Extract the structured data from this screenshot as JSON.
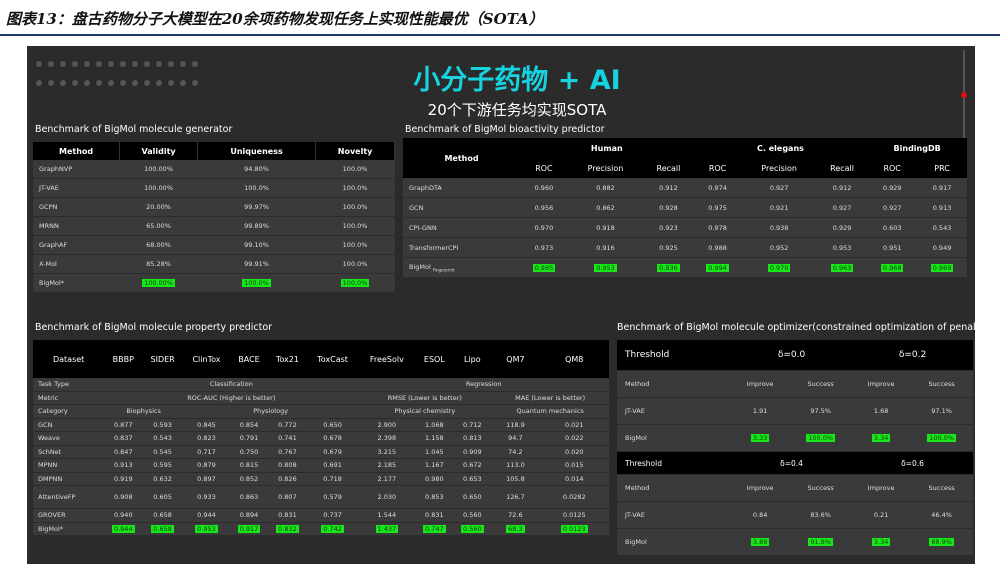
{
  "figure_title": "图表13：盘古药物分子大模型在20余项药物发现任务上实现性能最优（SOTA）",
  "hero": {
    "title": "小分子药物 + AI",
    "subtitle": "20个下游任务均实现SOTA"
  },
  "generator": {
    "heading": "Benchmark of BigMol molecule generator",
    "columns": [
      "Method",
      "Validity",
      "Uniqueness",
      "Novelty"
    ],
    "rows": [
      [
        "GraphNVP",
        "100.00%",
        "94.80%",
        "100.0%"
      ],
      [
        "JT-VAE",
        "100.00%",
        "100.0%",
        "100.0%"
      ],
      [
        "GCPN",
        "20.00%",
        "99.97%",
        "100.0%"
      ],
      [
        "MRNN",
        "65.00%",
        "99.89%",
        "100.0%"
      ],
      [
        "GraphAF",
        "68.00%",
        "99.10%",
        "100.0%"
      ],
      [
        "X-Mol",
        "85.28%",
        "99.91%",
        "100.0%"
      ]
    ],
    "best_row": [
      "BigMol*",
      "100.00%",
      "100.0%",
      "100.0%"
    ]
  },
  "bioactivity": {
    "heading": "Benchmark of BigMol bioactivity predictor",
    "method_label": "Method",
    "groups": [
      "Human",
      "C. elegans",
      "BindingDB"
    ],
    "metrics": [
      "ROC",
      "Precision",
      "Recall",
      "ROC",
      "Precision",
      "Recall",
      "ROC",
      "PRC"
    ],
    "rows": [
      [
        "GraphDTA",
        "0.960",
        "0.882",
        "0.912",
        "0.974",
        "0.927",
        "0.912",
        "0.929",
        "0.917"
      ],
      [
        "GCN",
        "0.956",
        "0.862",
        "0.928",
        "0.975",
        "0.921",
        "0.927",
        "0.927",
        "0.913"
      ],
      [
        "CPI-GNN",
        "0.970",
        "0.918",
        "0.923",
        "0.978",
        "0.938",
        "0.929",
        "0.603",
        "0.543"
      ],
      [
        "TransformerCPI",
        "0.973",
        "0.916",
        "0.925",
        "0.988",
        "0.952",
        "0.953",
        "0.951",
        "0.949"
      ]
    ],
    "best_row": [
      "BigMol",
      "0.985",
      "0.953",
      "0.936",
      "0.994",
      "0.970",
      "0.963",
      "0.968",
      "0.969"
    ],
    "best_row_suffix": "Fingerprint"
  },
  "property": {
    "heading": "Benchmark of BigMol molecule property predictor",
    "columns": [
      "Dataset",
      "BBBP",
      "SIDER",
      "ClinTox",
      "BACE",
      "Tox21",
      "ToxCast",
      "FreeSolv",
      "ESOL",
      "Lipo",
      "QM7",
      "QM8"
    ],
    "task_type": {
      "label": "Task Type",
      "classification": "Classification",
      "regression": "Regression"
    },
    "metric": {
      "label": "Metric",
      "roc": "ROC-AUC (Higher is better)",
      "rmse": "RMSE (Lower is better)",
      "mae": "MAE (Lower is better)"
    },
    "category": {
      "label": "Category",
      "biophysics": "Biophysics",
      "physiology": "Physiology",
      "physchem": "Physical chemistry",
      "quantum": "Quantum mechanics"
    },
    "rows": [
      [
        "GCN",
        "0.877",
        "0.593",
        "0.845",
        "0.854",
        "0.772",
        "0.650",
        "2.900",
        "1.068",
        "0.712",
        "118.9",
        "0.021"
      ],
      [
        "Weave",
        "0.837",
        "0.543",
        "0.823",
        "0.791",
        "0.741",
        "0.678",
        "2.398",
        "1.158",
        "0.813",
        "94.7",
        "0.022"
      ],
      [
        "SchNet",
        "0.847",
        "0.545",
        "0.717",
        "0.750",
        "0.767",
        "0.679",
        "3.215",
        "1.045",
        "0.909",
        "74.2",
        "0.020"
      ],
      [
        "MPNN",
        "0.913",
        "0.595",
        "0.879",
        "0.815",
        "0.808",
        "0.691",
        "2.185",
        "1.167",
        "0.672",
        "113.0",
        "0.015"
      ],
      [
        "DMPNN",
        "0.919",
        "0.632",
        "0.897",
        "0.852",
        "0.826",
        "0.718",
        "2.177",
        "0.980",
        "0.653",
        "105.8",
        "0.014"
      ],
      [
        "AttentiveFP",
        "0.908",
        "0.605",
        "0.933",
        "0.863",
        "0.807",
        "0.579",
        "2.030",
        "0.853",
        "0.650",
        "126.7",
        "0.0282"
      ],
      [
        "GROVER",
        "0.940",
        "0.658",
        "0.944",
        "0.894",
        "0.831",
        "0.737",
        "1.544",
        "0.831",
        "0.560",
        "72.6",
        "0.0125"
      ]
    ],
    "best_row": [
      "BigMol*",
      "0.944",
      "0.658",
      "0.953",
      "0.917",
      "0.832",
      "0.742",
      "1.437",
      "0.747",
      "0.560",
      "68.3",
      "0.0123"
    ]
  },
  "optimizer": {
    "heading": "Benchmark of BigMol molecule optimizer(constrained optimization of penalized logP)",
    "threshold_label": "Threshold",
    "blocks": [
      {
        "d1": "δ=0.0",
        "d2": "δ=0.2",
        "header": [
          "Method",
          "Improve",
          "Success",
          "Improve",
          "Success"
        ],
        "rows": [
          [
            "JT-VAE",
            "1.91",
            "97.5%",
            "1.68",
            "97.1%"
          ]
        ],
        "best": [
          "BigMol",
          "3.33",
          "100.0%",
          "3.34",
          "100.0%"
        ]
      },
      {
        "d1": "δ=0.4",
        "d2": "δ=0.6",
        "header": [
          "Method",
          "Improve",
          "Success",
          "Improve",
          "Success"
        ],
        "rows": [
          [
            "JT-VAE",
            "0.84",
            "83.6%",
            "0.21",
            "46.4%"
          ]
        ],
        "best": [
          "BigMol",
          "3.89",
          "91.8%",
          "3.34",
          "88.9%"
        ]
      }
    ]
  }
}
